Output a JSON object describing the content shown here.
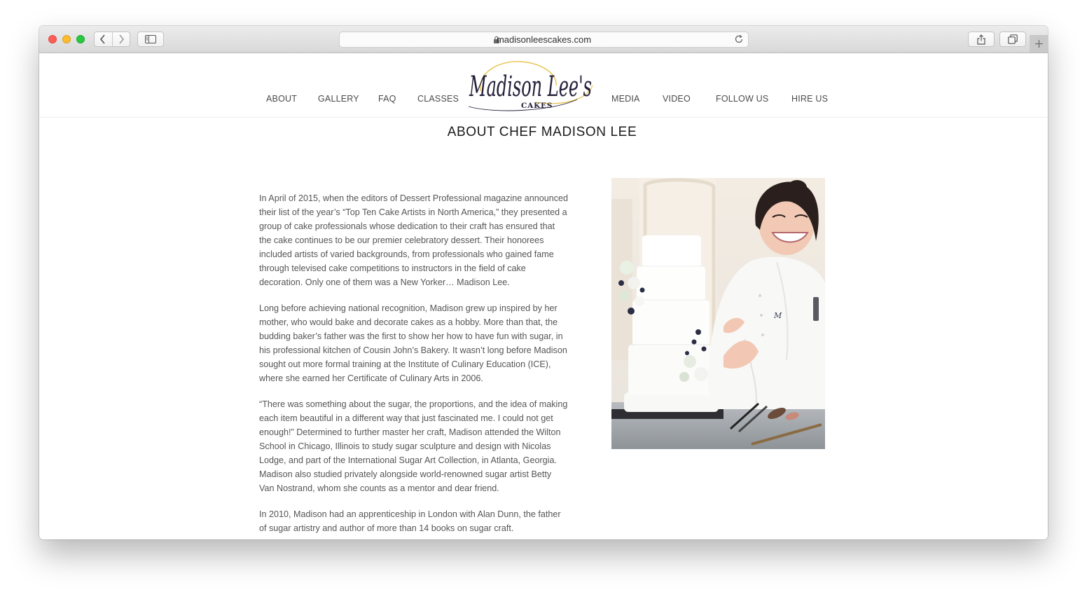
{
  "browser": {
    "url": "madisonleescakes.com"
  },
  "logo": {
    "script_text": "Madison Lee's",
    "sub_text": "CAKES"
  },
  "nav": {
    "items": [
      "ABOUT",
      "GALLERY",
      "FAQ",
      "CLASSES",
      "MEDIA",
      "VIDEO",
      "FOLLOW US",
      "HIRE US"
    ]
  },
  "page": {
    "title": "ABOUT CHEF MADISON LEE",
    "paragraphs": [
      "In April of 2015, when the editors of Dessert Professional magazine announced their list of the year’s “Top Ten Cake Artists in North America,” they presented a group of cake professionals whose dedication to their craft has ensured that the cake continues to be our premier celebratory dessert. Their honorees included artists of varied backgrounds, from professionals who gained fame through televised cake competitions to instructors in the field of cake decoration. Only one of them was a New Yorker… Madison Lee.",
      "Long before achieving national recognition, Madison grew up inspired by her mother, who would bake and decorate cakes as a hobby. More than that, the budding baker’s father was the first to show her how to have fun with sugar, in his professional kitchen of Cousin John’s Bakery.  It wasn’t long before Madison sought out more formal training at the Institute of Culinary Education (ICE), where she earned her Certificate of Culinary Arts in 2006.",
      "“There was something about the sugar, the proportions, and the idea of making each item beautiful in a different way that just fascinated me. I could not get enough!” Determined to further master her craft, Madison attended the Wilton School in Chicago, Illinois to study sugar sculpture and design with Nicolas Lodge, and part of the International Sugar Art Collection, in Atlanta, Georgia. Madison also studied privately alongside world-renowned sugar artist Betty Van Nostrand, whom she counts as a mentor and dear friend.",
      "In 2010, Madison had an apprenticeship in London with Alan Dunn, the father of sugar artistry and author of more than 14 books on sugar craft."
    ]
  },
  "colors": {
    "logo_ink": "#23203a",
    "logo_gold": "#e8c34a",
    "nav_text": "#4a4a4a",
    "body_text": "#555555"
  }
}
